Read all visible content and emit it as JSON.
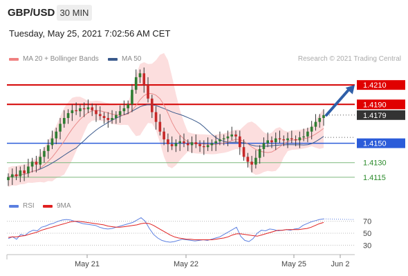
{
  "header": {
    "symbol": "GBP/USD",
    "timeframe": "30 MIN",
    "datetime": "Tuesday, May 25, 2021 7:02:56 AM CET"
  },
  "legend": {
    "ma20_label": "MA 20 + Bollinger Bands",
    "ma50_label": "MA 50",
    "ma20_color": "#f08080",
    "ma50_color": "#3a5a8c",
    "credit": "Research © 2021 Trading Central",
    "rsi_label": "RSI",
    "ma9_label": "9MA",
    "rsi_color": "#5b7fe0",
    "ma9_color": "#e02020"
  },
  "chart_data": [
    {
      "type": "candlestick",
      "title": "",
      "x_ticks": [
        "May 21",
        "May 22",
        "May 25",
        "Jun 2"
      ],
      "ylim": [
        1.4095,
        1.423
      ],
      "levels": [
        {
          "value": 1.421,
          "label": "1.4210",
          "kind": "resistance",
          "color": "#e00000"
        },
        {
          "value": 1.419,
          "label": "1.4190",
          "kind": "resistance",
          "color": "#e00000"
        },
        {
          "value": 1.4179,
          "label": "1.4179",
          "kind": "last",
          "color": "#333333"
        },
        {
          "value": 1.415,
          "label": "1.4150",
          "kind": "pivot",
          "color": "#2b5cd9"
        },
        {
          "value": 1.413,
          "label": "1.4130",
          "kind": "support",
          "color": "#2a8a2a"
        },
        {
          "value": 1.4115,
          "label": "1.4115",
          "kind": "support",
          "color": "#2a8a2a"
        }
      ],
      "arrow_target": 1.421,
      "close_series": [
        1.4115,
        1.4118,
        1.4116,
        1.4122,
        1.4119,
        1.4126,
        1.4131,
        1.4128,
        1.4136,
        1.4142,
        1.4148,
        1.4155,
        1.4162,
        1.417,
        1.4176,
        1.4181,
        1.4184,
        1.4183,
        1.4186,
        1.4185,
        1.4187,
        1.4184,
        1.418,
        1.4178,
        1.4176,
        1.4174,
        1.4176,
        1.4179,
        1.4183,
        1.4186,
        1.419,
        1.4205,
        1.4218,
        1.4222,
        1.421,
        1.4196,
        1.4182,
        1.4172,
        1.4162,
        1.4154,
        1.4149,
        1.4147,
        1.415,
        1.4152,
        1.415,
        1.4148,
        1.4151,
        1.4149,
        1.4147,
        1.4146,
        1.4148,
        1.415,
        1.4152,
        1.4154,
        1.4155,
        1.4157,
        1.4159,
        1.4157,
        1.4146,
        1.4136,
        1.4131,
        1.4128,
        1.4135,
        1.4144,
        1.415,
        1.4153,
        1.4151,
        1.4155,
        1.4154,
        1.4153,
        1.4155,
        1.4154,
        1.4153,
        1.4156,
        1.4157,
        1.4162,
        1.4167,
        1.4172,
        1.4176,
        1.4179
      ]
    },
    {
      "type": "line",
      "title": "",
      "ylim": [
        20,
        80
      ],
      "y_ticks": [
        70,
        50,
        30
      ],
      "series": [
        {
          "name": "RSI",
          "values": [
            41,
            44,
            40,
            48,
            46,
            52,
            55,
            54,
            60,
            62,
            65,
            67,
            70,
            72,
            73,
            72,
            70,
            68,
            66,
            65,
            64,
            63,
            60,
            58,
            57,
            58,
            60,
            62,
            64,
            66,
            68,
            72,
            76,
            70,
            58,
            48,
            42,
            38,
            36,
            35,
            36,
            38,
            40,
            39,
            38,
            37,
            38,
            39,
            38,
            40,
            42,
            44,
            48,
            52,
            56,
            60,
            45,
            38,
            36,
            41,
            50,
            55,
            54,
            57,
            56,
            54,
            55,
            56,
            55,
            57,
            58,
            63,
            66,
            69,
            71,
            73,
            74
          ]
        },
        {
          "name": "9MA",
          "values": [
            43,
            44,
            44,
            45,
            46,
            48,
            50,
            52,
            55,
            57,
            59,
            61,
            63,
            65,
            67,
            69,
            70,
            70,
            69,
            68,
            67,
            66,
            65,
            64,
            62,
            61,
            60,
            60,
            61,
            62,
            63,
            64,
            66,
            67,
            66,
            63,
            59,
            55,
            51,
            47,
            44,
            42,
            41,
            40,
            40,
            39,
            39,
            39,
            39,
            39,
            40,
            41,
            42,
            44,
            47,
            49,
            49,
            48,
            47,
            46,
            45,
            47,
            49,
            51,
            53,
            55,
            55,
            56,
            56,
            56,
            56,
            57,
            58,
            60,
            63,
            66,
            68
          ]
        }
      ]
    }
  ]
}
